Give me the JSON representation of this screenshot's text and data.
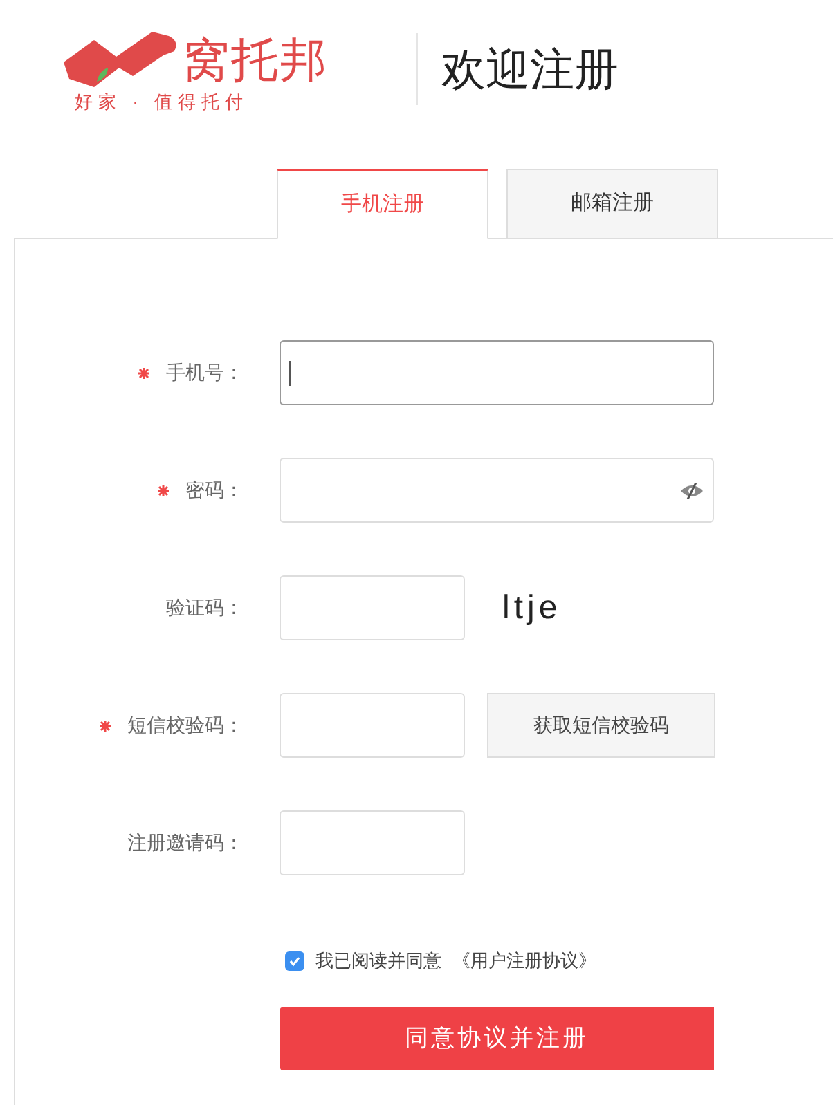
{
  "logo": {
    "name": "窝托邦",
    "slogan": "好家 · 值得托付"
  },
  "title": "欢迎注册",
  "tabs": [
    {
      "label": "手机注册",
      "selected": true
    },
    {
      "label": "邮箱注册",
      "selected": false
    }
  ],
  "fields": [
    {
      "kind": "text",
      "label": "手机号：",
      "required": true,
      "focused": true
    },
    {
      "kind": "password",
      "label": "密码：",
      "required": true,
      "focused": false
    },
    {
      "kind": "captcha",
      "label": "验证码：",
      "required": false,
      "focused": false,
      "captcha": "ltje"
    },
    {
      "kind": "sms",
      "label": "短信校验码：",
      "required": true,
      "focused": false,
      "button": "获取短信校验码"
    },
    {
      "kind": "short",
      "label": "注册邀请码：",
      "required": false,
      "focused": false
    }
  ],
  "agreement": {
    "checked": true,
    "text": "我已阅读并同意",
    "link": "《用户注册协议》"
  },
  "submit": "同意协议并注册"
}
